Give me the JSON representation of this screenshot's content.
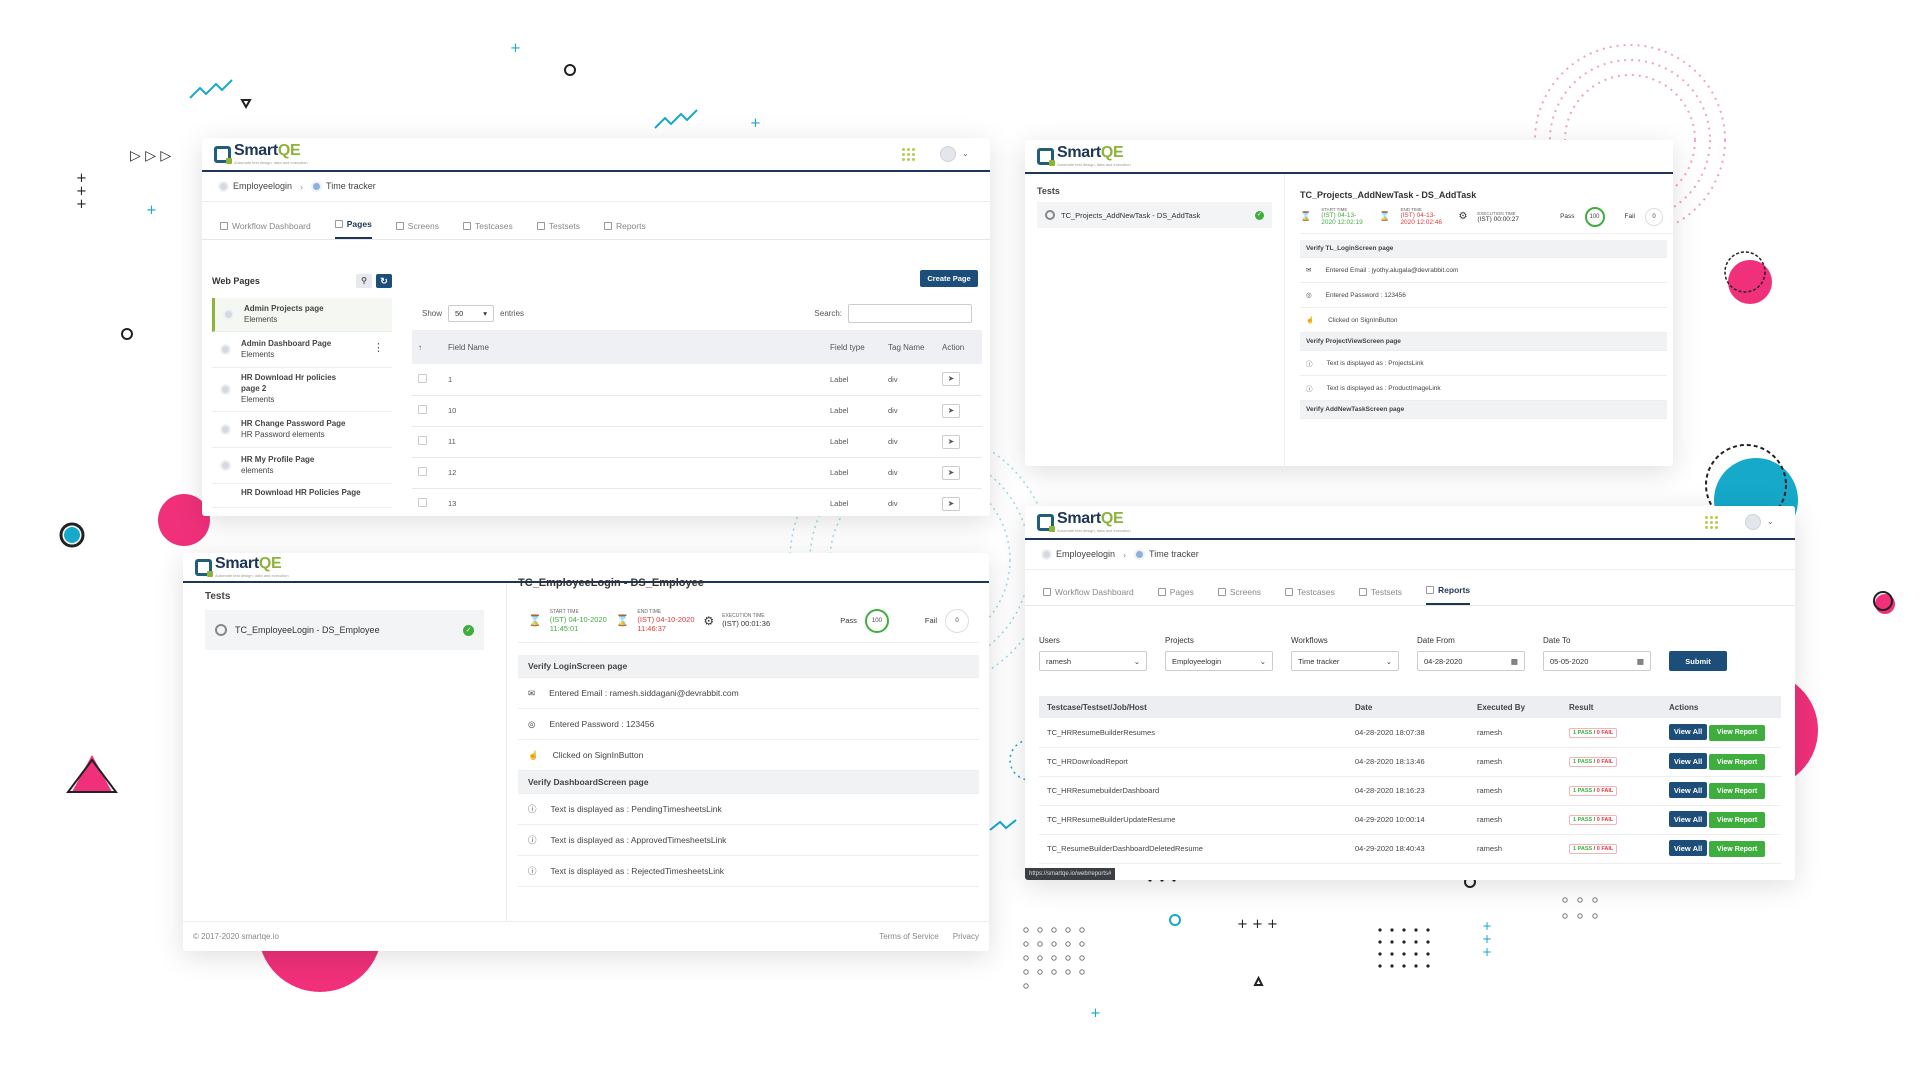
{
  "brand": {
    "name_a": "Smart",
    "name_b": "QE",
    "tagline": "Automate test design, data and execution"
  },
  "colors": {
    "navy": "#1d3557",
    "green": "#3fae3f",
    "red": "#e03a3a",
    "accent_pink": "#f0307a",
    "accent_teal": "#16a9c9",
    "lime": "#8db33a"
  },
  "w1": {
    "breadcrumb": [
      "Employeelogin",
      "Time tracker"
    ],
    "tabs": [
      "Workflow Dashboard",
      "Pages",
      "Screens",
      "Testcases",
      "Testsets",
      "Reports"
    ],
    "sidebar_title": "Web Pages",
    "sidebar": [
      {
        "name": "Admin Projects page",
        "sub": "Elements"
      },
      {
        "name": "Admin Dashboard Page",
        "sub": "Elements"
      },
      {
        "name": "HR Download Hr policies page 2",
        "sub": "Elements"
      },
      {
        "name": "HR Change Password Page",
        "sub": "HR Password elements"
      },
      {
        "name": "HR My Profile Page",
        "sub": "elements"
      },
      {
        "name": "HR Download HR Policies Page",
        "sub": ""
      }
    ],
    "create_label": "Create Page",
    "show_label": "Show",
    "entries_value": "50",
    "entries_label": "entries",
    "search_label": "Search:",
    "columns": [
      "Field Name",
      "Field type",
      "Tag Name",
      "Action"
    ],
    "rows": [
      [
        "1",
        "Label",
        "div"
      ],
      [
        "10",
        "Label",
        "div"
      ],
      [
        "11",
        "Label",
        "div"
      ],
      [
        "12",
        "Label",
        "div"
      ],
      [
        "13",
        "Label",
        "div"
      ]
    ]
  },
  "w2": {
    "tests_label": "Tests",
    "test_item": "TC_Projects_AddNewTask - DS_AddTask",
    "title": "TC_Projects_AddNewTask - DS_AddTask",
    "start_label": "START TIME",
    "start": "(IST) 04-13-2020 12:02:19",
    "end_label": "END TIME",
    "end": "(IST) 04-13-2020 12:02:46",
    "exec_label": "EXECUTION TIME",
    "exec": "(IST) 00:00:27",
    "pass_label": "Pass",
    "pass_val": "100",
    "fail_label": "Fail",
    "fail_val": "0",
    "lines": [
      {
        "type": "sec",
        "text": "Verify TL_LoginScreen page"
      },
      {
        "type": "line",
        "icon": "email",
        "text": "Entered Email : jyothy.alugala@devrabbit.com"
      },
      {
        "type": "line",
        "icon": "eye",
        "text": "Entered Password : 123456"
      },
      {
        "type": "line",
        "icon": "click",
        "text": "Clicked on SignInButton"
      },
      {
        "type": "sec",
        "text": "Verify ProjectViewScreen page"
      },
      {
        "type": "line",
        "icon": "info",
        "text": "Text is displayed as : ProjectsLink"
      },
      {
        "type": "line",
        "icon": "info",
        "text": "Text is displayed as : ProductImageLink"
      },
      {
        "type": "sec",
        "text": "Verify AddNewTaskScreen page"
      }
    ]
  },
  "w3": {
    "tests_label": "Tests",
    "test_item": "TC_EmployeeLogin - DS_Employee",
    "title": "TC_EmployeeLogin - DS_Employee",
    "start_label": "START TIME",
    "start": "(IST) 04-10-2020 11:45:01",
    "end_label": "END TIME",
    "end": "(IST) 04-10-2020 11:46:37",
    "exec_label": "EXECUTION TIME",
    "exec": "(IST) 00:01:36",
    "pass_label": "Pass",
    "pass_val": "100",
    "fail_label": "Fail",
    "fail_val": "0",
    "lines": [
      {
        "type": "sec",
        "text": "Verify LoginScreen page"
      },
      {
        "type": "line",
        "icon": "email",
        "text": "Entered Email : ramesh.siddagani@devrabbit.com"
      },
      {
        "type": "line",
        "icon": "eye",
        "text": "Entered Password : 123456"
      },
      {
        "type": "line",
        "icon": "click",
        "text": "Clicked on SignInButton"
      },
      {
        "type": "sec",
        "text": "Verify DashboardScreen page"
      },
      {
        "type": "line",
        "icon": "info",
        "text": "Text is displayed as : PendingTimesheetsLink"
      },
      {
        "type": "line",
        "icon": "info",
        "text": "Text is displayed as : ApprovedTimesheetsLink"
      },
      {
        "type": "line",
        "icon": "info",
        "text": "Text is displayed as : RejectedTimesheetsLink"
      }
    ],
    "copyright": "© 2017-2020 smartqe.io",
    "terms": "Terms of Service",
    "privacy": "Privacy"
  },
  "w4": {
    "breadcrumb": [
      "Employeelogin",
      "Time tracker"
    ],
    "tabs": [
      "Workflow Dashboard",
      "Pages",
      "Screens",
      "Testcases",
      "Testsets",
      "Reports"
    ],
    "filters": [
      {
        "label": "Users",
        "value": "ramesh"
      },
      {
        "label": "Projects",
        "value": "Employeelogin"
      },
      {
        "label": "Workflows",
        "value": "Time tracker"
      },
      {
        "label": "Date From",
        "value": "04-28-2020"
      },
      {
        "label": "Date To",
        "value": "05-05-2020"
      }
    ],
    "submit": "Submit",
    "columns": [
      "Testcase/Testset/Job/Host",
      "Date",
      "Executed By",
      "Result",
      "Actions"
    ],
    "rows": [
      [
        "TC_HRResumeBuilderResumes",
        "04-28-2020 18:07:38",
        "ramesh"
      ],
      [
        "TC_HRDownloadReport",
        "04-28-2020 18:13:46",
        "ramesh"
      ],
      [
        "TC_HRResumebuilderDashboard",
        "04-28-2020 18:16:23",
        "ramesh"
      ],
      [
        "TC_HRResumeBuilderUpdateResume",
        "04-29-2020 10:00:14",
        "ramesh"
      ],
      [
        "TC_ResumeBuilderDashboardDeletedResume",
        "04-29-2020 18:40:43",
        "ramesh"
      ]
    ],
    "pass_text": "1 PASS",
    "fail_text": "0 FAIL",
    "view_all": "View All",
    "view_report": "View Report",
    "status_url": "https://smartqe.io/web/reports#"
  }
}
